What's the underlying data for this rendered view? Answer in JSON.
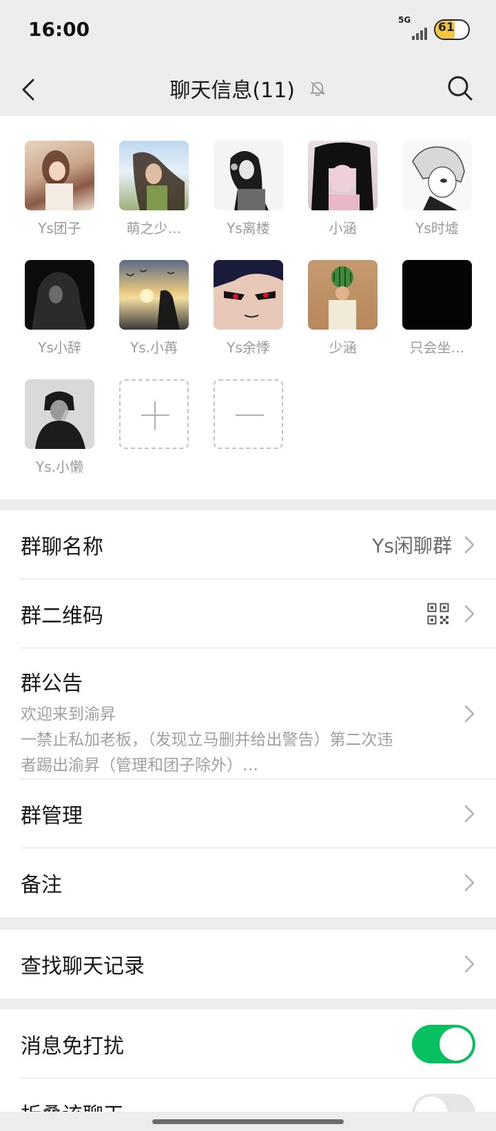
{
  "status": {
    "time": "16:00",
    "network": "5G",
    "battery": "61"
  },
  "nav": {
    "title": "聊天信息(11)"
  },
  "members": [
    {
      "name": "Ys团子",
      "avatar": "photo-girl-couch"
    },
    {
      "name": "萌之少…",
      "avatar": "photo-girl-sky"
    },
    {
      "name": "Ys离楼",
      "avatar": "sketch-girl"
    },
    {
      "name": "小涵",
      "avatar": "photo-girl-dark-hair"
    },
    {
      "name": "Ys时墟",
      "avatar": "anime-boy-sketch"
    },
    {
      "name": "Ys小辞",
      "avatar": "dark-hooded-figure"
    },
    {
      "name": "Ys.小苒",
      "avatar": "sunset-birds"
    },
    {
      "name": "Ys余悸",
      "avatar": "anime-red-eyes"
    },
    {
      "name": "少涵",
      "avatar": "watermelon-head"
    },
    {
      "name": "只会坐…",
      "avatar": "black-square"
    },
    {
      "name": "Ys.小懒",
      "avatar": "bw-man-thinking"
    }
  ],
  "settings": {
    "group_name_label": "群聊名称",
    "group_name_value": "Ys闲聊群",
    "qr_label": "群二维码",
    "notice_label": "群公告",
    "notice_line1": "欢迎来到渝昇",
    "notice_line2": "一禁止私加老板，（发现立马删并给出警告）第二次违",
    "notice_line3": "者踢出渝昇（管理和团子除外）…",
    "manage_label": "群管理",
    "remark_label": "备注",
    "search_label": "查找聊天记录",
    "mute_label": "消息免打扰",
    "mute_on": true,
    "fold_label": "折叠该聊天",
    "fold_on": false
  },
  "colors": {
    "accent": "#07c160",
    "background": "#ededed"
  }
}
